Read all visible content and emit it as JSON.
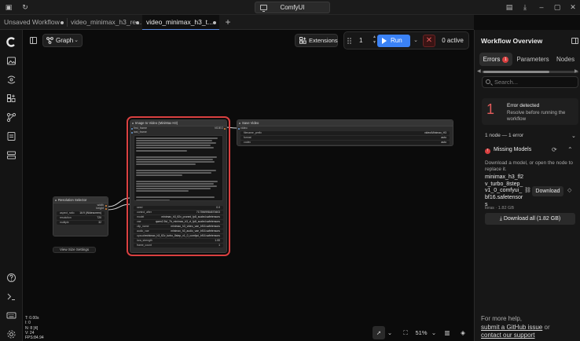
{
  "window": {
    "title": "ComfyUI"
  },
  "tabs": [
    {
      "label": "Unsaved Workflow"
    },
    {
      "label": "video_minimax_h3_re..."
    },
    {
      "label": "video_minimax_h3_t..."
    }
  ],
  "toolbar": {
    "graph_label": "Graph",
    "extensions_label": "Extensions",
    "queue_count": "1",
    "run_label": "Run",
    "active_label": "0 active"
  },
  "nodes": {
    "main": {
      "title": "Image to Video (MiniMax H3)",
      "inputs": [
        "first_frame",
        "last_frame"
      ],
      "output": "VIDEO",
      "widgets": [
        {
          "label": "seed",
          "value": "0.0"
        },
        {
          "label": "control_after",
          "value": "7173969984870603"
        },
        {
          "label": "model",
          "value": "minimax_h3_fl2v_pruned_fp8_scaled.safetensors"
        },
        {
          "label": "vae",
          "value": "qwen2.5vl_7b_minimax_h3_vl_fp8_scaled.safetensors"
        },
        {
          "label": "clip_name",
          "value": "minimax_h3_video_vae_bf16.safetensors"
        },
        {
          "label": "audio_vae",
          "value": "minimax_h3_audio_vae_bf16.safetensors"
        },
        {
          "label": "upscale",
          "value": "minimax_h3_fl2v_turbo_8step_v1_0_comfyui_bf16.safetensors"
        },
        {
          "label": "lora_strength",
          "value": "1.00"
        },
        {
          "label": "frame_count",
          "value": "1"
        }
      ]
    },
    "save": {
      "title": "Save Video",
      "input": "video",
      "widgets": [
        {
          "label": "filename_prefix",
          "value": "video/Minimax_H3"
        },
        {
          "label": "format",
          "value": "auto"
        },
        {
          "label": "codec",
          "value": "auto"
        }
      ]
    },
    "resolution": {
      "title": "Resolution Selector",
      "rows": [
        {
          "label": "aspect_ratio",
          "value": "16:9 (Widescreen)"
        },
        {
          "label": "resolution",
          "value": "720"
        },
        {
          "label": "multiple",
          "value": "32"
        }
      ],
      "outputs": [
        "width",
        "height"
      ]
    },
    "group": {
      "label": "View Size Settings"
    }
  },
  "stats": {
    "lines": [
      "T: 0.00s",
      "I: 0",
      "N: 8 [4]",
      "V: 24",
      "FPS:84.94"
    ]
  },
  "canvas_tools": {
    "zoom": "51%"
  },
  "right_panel": {
    "title": "Workflow Overview",
    "tabs": [
      "Errors",
      "Parameters",
      "Nodes"
    ],
    "errors_badge": "1",
    "search_placeholder": "Search...",
    "error_count": "1",
    "error_title": "Error detected",
    "error_desc": "Resolve before running the workflow",
    "summary": "1 node — 1 error",
    "section_title": "Missing Models",
    "section_badge": "!",
    "section_desc": "Download a model, or open the node to replace it.",
    "model_name": "minimax_h3_fl2v_turbo_8step_v1_0_comfyui_bf16.safetensors",
    "model_size": "loras · 1.82 GB",
    "download_label": "Download",
    "download_all_label": "Download all (1.82 GB)",
    "help_prefix": "For more help,",
    "help_link1": "submit a GitHub issue",
    "help_or": "or",
    "help_link2": "contact our support"
  },
  "colors": {
    "accent": "#3b82f6",
    "error": "#d94040"
  }
}
